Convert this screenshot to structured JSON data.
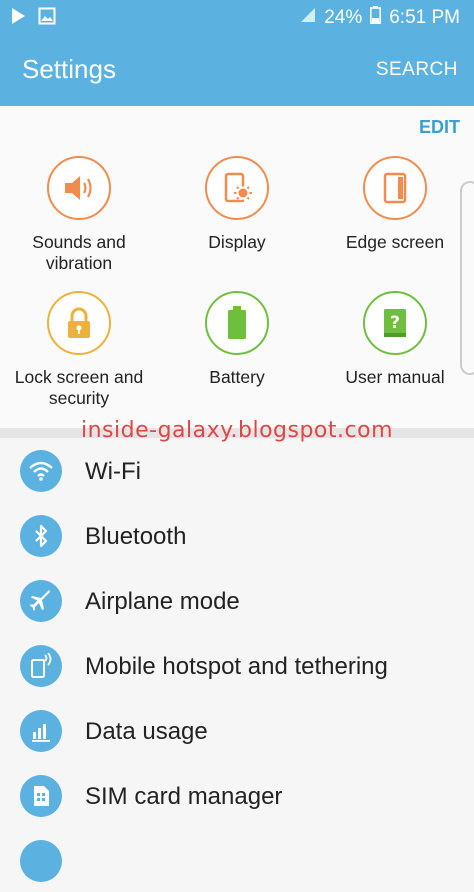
{
  "status_bar": {
    "battery": "24%",
    "time": "6:51 PM"
  },
  "app_bar": {
    "title": "Settings",
    "search_label": "SEARCH"
  },
  "quick_settings": {
    "edit_label": "EDIT",
    "items": [
      {
        "label": "Sounds and vibration",
        "icon": "speaker-icon",
        "color": "#ef8c4e"
      },
      {
        "label": "Display",
        "icon": "display-brightness-icon",
        "color": "#ef8c4e"
      },
      {
        "label": "Edge screen",
        "icon": "edge-screen-icon",
        "color": "#ef8c4e"
      },
      {
        "label": "Lock screen and security",
        "icon": "lock-icon",
        "color": "#eeb13c"
      },
      {
        "label": "Battery",
        "icon": "battery-icon",
        "color": "#6fbf3f"
      },
      {
        "label": "User manual",
        "icon": "manual-book-icon",
        "color": "#6fbf3f"
      }
    ]
  },
  "watermark": "inside-galaxy.blogspot.com",
  "settings_list": [
    {
      "label": "Wi-Fi",
      "icon": "wifi-icon"
    },
    {
      "label": "Bluetooth",
      "icon": "bluetooth-icon"
    },
    {
      "label": "Airplane mode",
      "icon": "airplane-icon"
    },
    {
      "label": "Mobile hotspot and tethering",
      "icon": "hotspot-icon"
    },
    {
      "label": "Data usage",
      "icon": "data-usage-icon"
    },
    {
      "label": "SIM card manager",
      "icon": "sim-card-icon"
    }
  ],
  "colors": {
    "accent": "#5bb2e0",
    "orange": "#ef8c4e",
    "yellow": "#eeb13c",
    "green": "#6fbf3f",
    "watermark": "#e04646"
  }
}
